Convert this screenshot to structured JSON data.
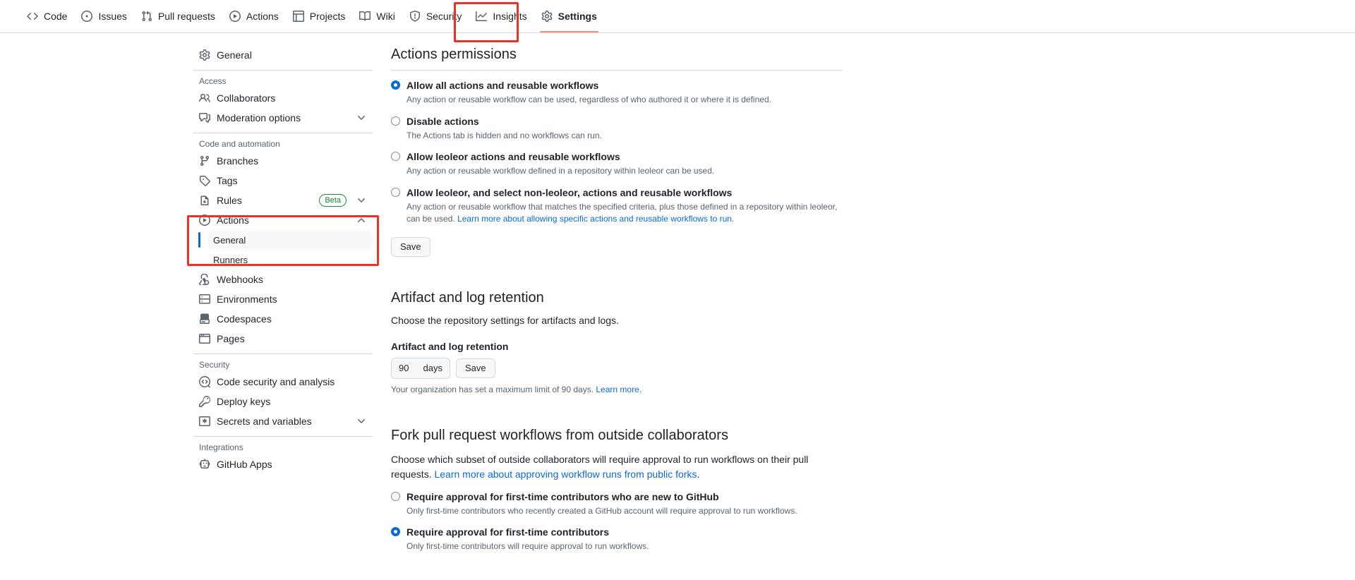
{
  "repo_nav": {
    "items": [
      {
        "label": "Code",
        "icon": "code-icon",
        "selected": false
      },
      {
        "label": "Issues",
        "icon": "issue-opened-icon",
        "selected": false
      },
      {
        "label": "Pull requests",
        "icon": "git-pull-request-icon",
        "selected": false
      },
      {
        "label": "Actions",
        "icon": "play-icon",
        "selected": false
      },
      {
        "label": "Projects",
        "icon": "table-icon",
        "selected": false
      },
      {
        "label": "Wiki",
        "icon": "book-icon",
        "selected": false
      },
      {
        "label": "Security",
        "icon": "shield-icon",
        "selected": false
      },
      {
        "label": "Insights",
        "icon": "graph-icon",
        "selected": false
      },
      {
        "label": "Settings",
        "icon": "gear-icon",
        "selected": true
      }
    ]
  },
  "sidebar": {
    "general": {
      "label": "General",
      "icon": "gear-icon"
    },
    "groups": [
      {
        "heading": "Access",
        "items": [
          {
            "label": "Collaborators",
            "icon": "people-icon",
            "chevron": false
          },
          {
            "label": "Moderation options",
            "icon": "comment-discussion-icon",
            "chevron": true
          }
        ]
      },
      {
        "heading": "Code and automation",
        "items": [
          {
            "label": "Branches",
            "icon": "git-branch-icon",
            "chevron": false
          },
          {
            "label": "Tags",
            "icon": "tag-icon",
            "chevron": false
          },
          {
            "label": "Rules",
            "icon": "rules-icon",
            "chevron": true,
            "badge": "Beta"
          },
          {
            "label": "Actions",
            "icon": "play-icon",
            "chevron": true,
            "expanded": true,
            "sub_items": [
              {
                "label": "General",
                "active": true
              },
              {
                "label": "Runners",
                "active": false
              }
            ]
          },
          {
            "label": "Webhooks",
            "icon": "webhook-icon",
            "chevron": false
          },
          {
            "label": "Environments",
            "icon": "server-icon",
            "chevron": false
          },
          {
            "label": "Codespaces",
            "icon": "codespaces-icon",
            "chevron": false
          },
          {
            "label": "Pages",
            "icon": "browser-icon",
            "chevron": false
          }
        ]
      },
      {
        "heading": "Security",
        "items": [
          {
            "label": "Code security and analysis",
            "icon": "code-review-icon",
            "chevron": false
          },
          {
            "label": "Deploy keys",
            "icon": "key-icon",
            "chevron": false
          },
          {
            "label": "Secrets and variables",
            "icon": "asterisk-icon",
            "chevron": true
          }
        ]
      },
      {
        "heading": "Integrations",
        "items": [
          {
            "label": "GitHub Apps",
            "icon": "apps-icon",
            "chevron": false
          }
        ]
      }
    ]
  },
  "main": {
    "actions_permissions": {
      "title": "Actions permissions",
      "options": [
        {
          "label": "Allow all actions and reusable workflows",
          "desc": "Any action or reusable workflow can be used, regardless of who authored it or where it is defined.",
          "checked": true
        },
        {
          "label": "Disable actions",
          "desc": "The Actions tab is hidden and no workflows can run.",
          "checked": false
        },
        {
          "label": "Allow leoleor actions and reusable workflows",
          "desc": "Any action or reusable workflow defined in a repository within leoleor can be used.",
          "checked": false
        },
        {
          "label": "Allow leoleor, and select non-leoleor, actions and reusable workflows",
          "desc": "Any action or reusable workflow that matches the specified criteria, plus those defined in a repository within leoleor, can be used. ",
          "link_text": "Learn more about allowing specific actions and reusable workflows to run",
          "desc_tail": ".",
          "checked": false
        }
      ],
      "save_label": "Save"
    },
    "artifact_retention": {
      "title": "Artifact and log retention",
      "description": "Choose the repository settings for artifacts and logs.",
      "field_label": "Artifact and log retention",
      "value": "90",
      "unit": "days",
      "save_label": "Save",
      "note_text": "Your organization has set a maximum limit of 90 days. ",
      "note_link": "Learn more."
    },
    "fork_pr": {
      "title": "Fork pull request workflows from outside collaborators",
      "description": "Choose which subset of outside collaborators will require approval to run workflows on their pull requests. ",
      "description_link": "Learn more about approving workflow runs from public forks",
      "description_tail": ".",
      "options": [
        {
          "label": "Require approval for first-time contributors who are new to GitHub",
          "desc": "Only first-time contributors who recently created a GitHub account will require approval to run workflows.",
          "checked": false
        },
        {
          "label": "Require approval for first-time contributors",
          "desc": "Only first-time contributors will require approval to run workflows.",
          "checked": true
        }
      ]
    }
  },
  "colors": {
    "accent": "#0969da",
    "highlight_box": "#ef3125",
    "tab_underline": "#fd8c73",
    "beta_border": "#1f883d"
  }
}
